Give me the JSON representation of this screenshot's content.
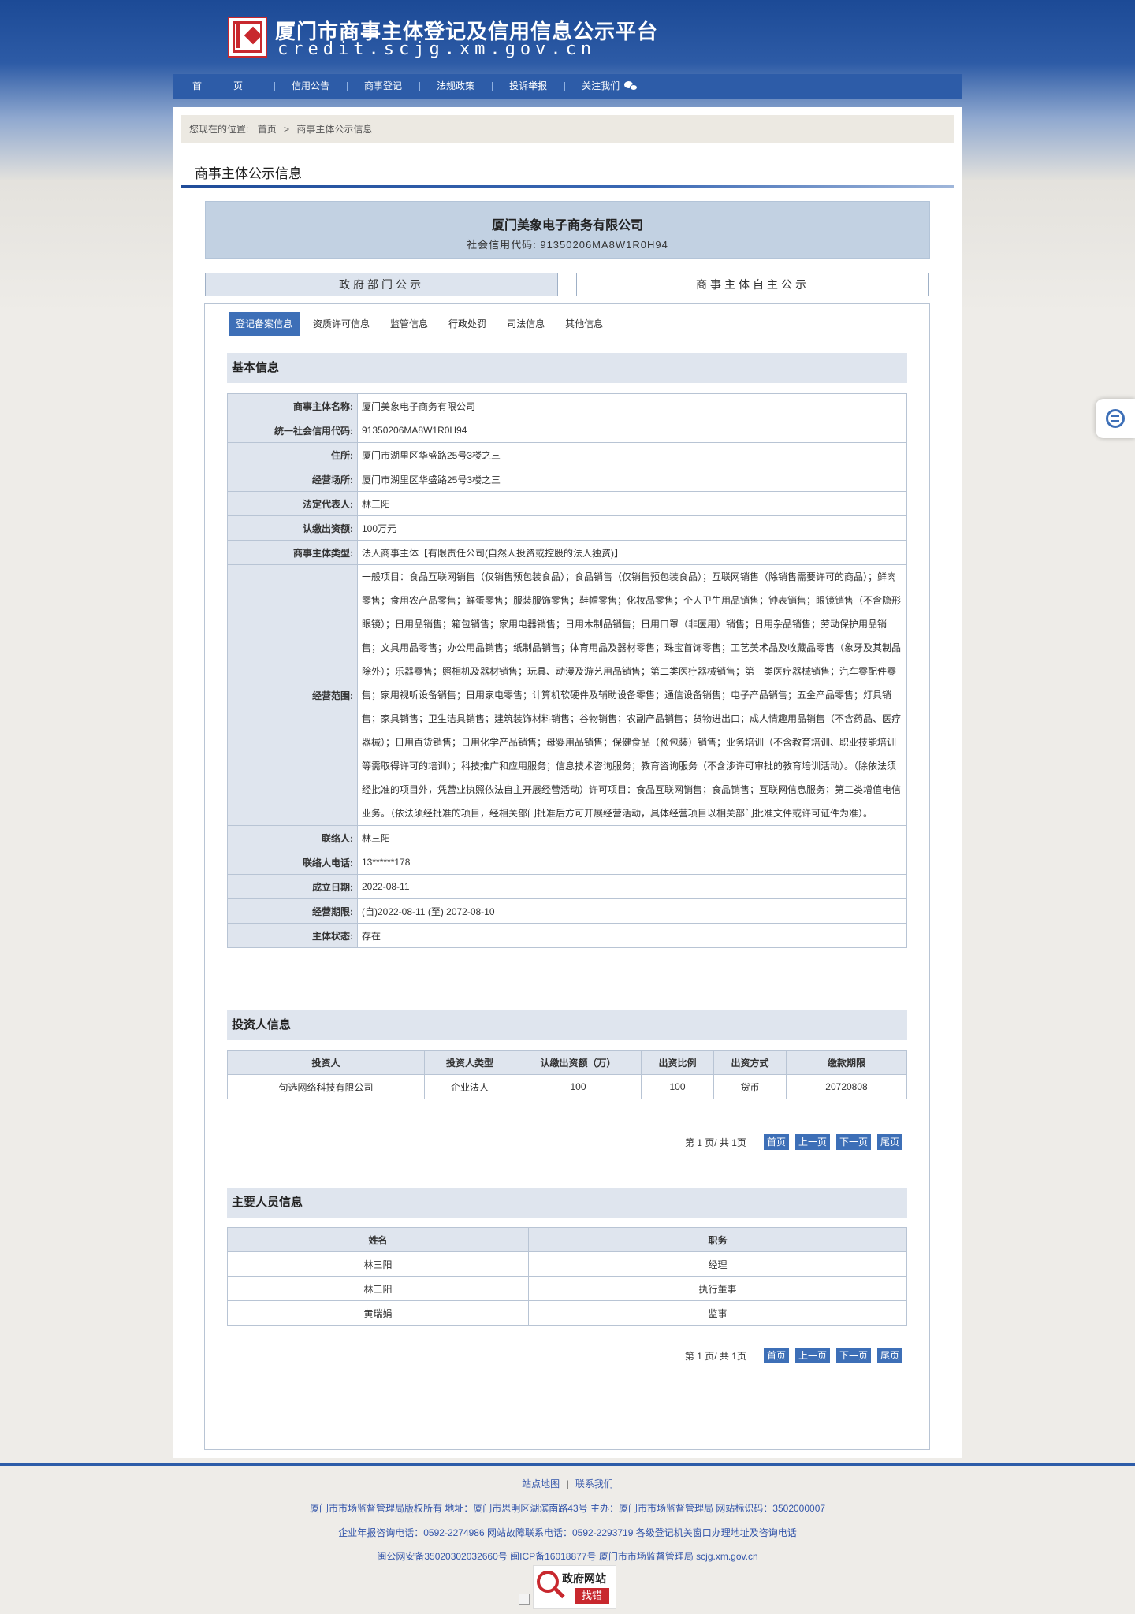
{
  "header": {
    "title": "厦门市商事主体登记及信用信息公示平台",
    "domain": "credit.scjg.xm.gov.cn"
  },
  "nav": {
    "items": [
      "首页",
      "信用公告",
      "商事登记",
      "法规政策",
      "投诉举报",
      "关注我们"
    ]
  },
  "breadcrumb": {
    "label": "您现在的位置:",
    "home": "首页",
    "separator": ">",
    "current": "商事主体公示信息"
  },
  "page_title": "商事主体公示信息",
  "company": {
    "name": "厦门美象电子商务有限公司",
    "credit_code_line": "社会信用代码: 91350206MA8W1R0H94"
  },
  "top_tabs": {
    "government": "政府部门公示",
    "self": "商事主体自主公示"
  },
  "subtabs": [
    "登记备案信息",
    "资质许可信息",
    "监管信息",
    "行政处罚",
    "司法信息",
    "其他信息"
  ],
  "basic": {
    "heading": "基本信息",
    "rows": [
      {
        "key": "商事主体名称:",
        "value": "厦门美象电子商务有限公司"
      },
      {
        "key": "统一社会信用代码:",
        "value": "91350206MA8W1R0H94"
      },
      {
        "key": "住所:",
        "value": "厦门市湖里区华盛路25号3楼之三"
      },
      {
        "key": "经营场所:",
        "value": "厦门市湖里区华盛路25号3楼之三"
      },
      {
        "key": "法定代表人:",
        "value": "林三阳"
      },
      {
        "key": "认缴出资额:",
        "value": "100万元"
      },
      {
        "key": "商事主体类型:",
        "value": "法人商事主体【有限责任公司(自然人投资或控股的法人独资)】"
      },
      {
        "key": "经营范围:",
        "value": "一般项目：食品互联网销售（仅销售预包装食品）；食品销售（仅销售预包装食品）；互联网销售（除销售需要许可的商品）；鲜肉零售；食用农产品零售；鲜蛋零售；服装服饰零售；鞋帽零售；化妆品零售；个人卫生用品销售；钟表销售；眼镜销售（不含隐形眼镜）；日用品销售；箱包销售；家用电器销售；日用木制品销售；日用口罩（非医用）销售；日用杂品销售；劳动保护用品销售；文具用品零售；办公用品销售；纸制品销售；体育用品及器材零售；珠宝首饰零售；工艺美术品及收藏品零售（象牙及其制品除外）；乐器零售；照相机及器材销售；玩具、动漫及游艺用品销售；第二类医疗器械销售；第一类医疗器械销售；汽车零配件零售；家用视听设备销售；日用家电零售；计算机软硬件及辅助设备零售；通信设备销售；电子产品销售；五金产品零售；灯具销售；家具销售；卫生洁具销售；建筑装饰材料销售；谷物销售；农副产品销售；货物进出口；成人情趣用品销售（不含药品、医疗器械）；日用百货销售；日用化学产品销售；母婴用品销售；保健食品（预包装）销售；业务培训（不含教育培训、职业技能培训等需取得许可的培训）；科技推广和应用服务；信息技术咨询服务；教育咨询服务（不含涉许可审批的教育培训活动）。（除依法须经批准的项目外，凭营业执照依法自主开展经营活动）许可项目：食品互联网销售；食品销售；互联网信息服务；第二类增值电信业务。（依法须经批准的项目，经相关部门批准后方可开展经营活动，具体经营项目以相关部门批准文件或许可证件为准）。"
      },
      {
        "key": "联络人:",
        "value": "林三阳"
      },
      {
        "key": "联络人电话:",
        "value": "13******178"
      },
      {
        "key": "成立日期:",
        "value": "2022-08-11"
      },
      {
        "key": "经营期限:",
        "value": "(自)2022-08-11 (至) 2072-08-10"
      },
      {
        "key": "主体状态:",
        "value": "存在"
      }
    ]
  },
  "investors": {
    "heading": "投资人信息",
    "columns": [
      "投资人",
      "投资人类型",
      "认缴出资额（万）",
      "出资比例",
      "出资方式",
      "缴款期限"
    ],
    "rows": [
      [
        "句选网络科技有限公司",
        "企业法人",
        "100",
        "100",
        "货币",
        "20720808"
      ]
    ]
  },
  "personnel": {
    "heading": "主要人员信息",
    "columns": [
      "姓名",
      "职务"
    ],
    "rows": [
      [
        "林三阳",
        "经理"
      ],
      [
        "林三阳",
        "执行董事"
      ],
      [
        "黄瑞娟",
        "监事"
      ]
    ]
  },
  "pager": {
    "summary": "第 1 页/ 共 1页",
    "first": "首页",
    "prev": "上一页",
    "next": "下一页",
    "last": "尾页"
  },
  "footer": {
    "links": [
      "站点地图",
      "联系我们"
    ],
    "link_sep": "|",
    "line1": "厦门市市场监督管理局版权所有  地址：厦门市思明区湖滨南路43号  主办：厦门市市场监督管理局  网站标识码：3502000007",
    "line2": "企业年报咨询电话：0592-2274986  网站故障联系电话：0592-2293719  各级登记机关窗口办理地址及咨询电话",
    "line3": "闽公网安备35020302032660号    闽ICP备16018877号  厦门市市场监督管理局 scjg.xm.gov.cn",
    "badge_top": "政府网站",
    "badge_bottom": "找错"
  },
  "colors": {
    "nav_blue": "#2d5ca8",
    "accent_blue": "#3d6fb7",
    "label_bg": "#dfe5ee",
    "brand_red": "#c8282e"
  }
}
